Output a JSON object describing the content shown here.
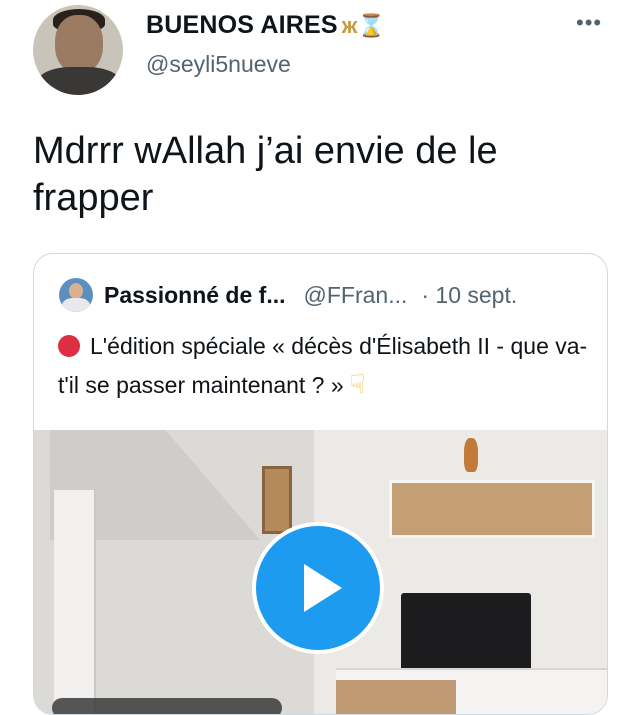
{
  "tweet": {
    "display_name": "BUENOS AIRES",
    "name_symbols": "ж⌛",
    "handle": "@seyli5nueve",
    "more_label": "•••",
    "text": "Mdrrr wAllah j’ai envie de le frapper"
  },
  "quoted": {
    "name": "Passionné de f...",
    "handle": "@FFran...",
    "time": "· 10 sept.",
    "text": "L'édition spéciale « décès d'Élisabeth II - que va-t'il se passer maintenant ? »",
    "lead_emoji": "red-circle",
    "trail_emoji": "☟"
  },
  "media": {
    "type": "video",
    "icon": "play-icon"
  },
  "colors": {
    "accent": "#1d9bf0",
    "text": "#0f1419",
    "muted": "#536471",
    "border": "#cfd9de"
  }
}
